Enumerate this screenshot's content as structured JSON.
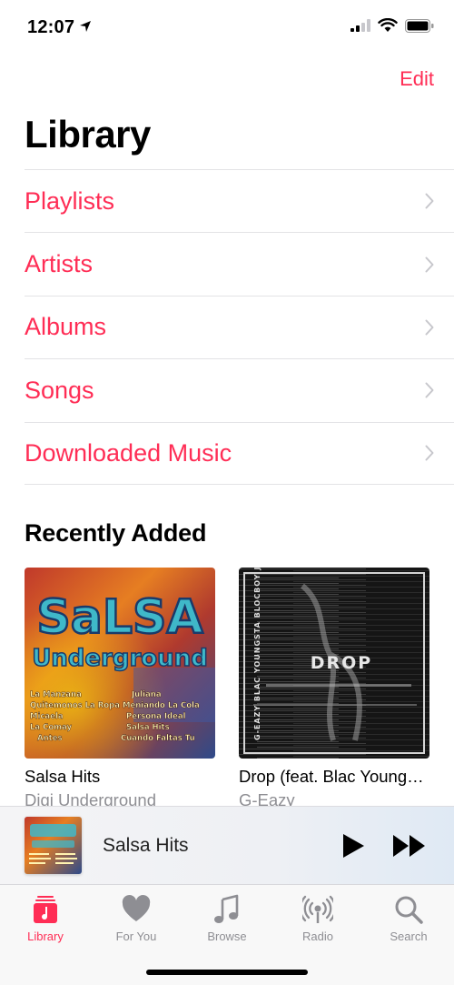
{
  "status_bar": {
    "time": "12:07"
  },
  "header": {
    "edit_label": "Edit",
    "title": "Library"
  },
  "menu": {
    "items": [
      {
        "label": "Playlists"
      },
      {
        "label": "Artists"
      },
      {
        "label": "Albums"
      },
      {
        "label": "Songs"
      },
      {
        "label": "Downloaded Music"
      }
    ]
  },
  "recently_added": {
    "title": "Recently Added",
    "albums": [
      {
        "title": "Salsa Hits",
        "artist": "Digi Underground",
        "art_title": "SaLSA",
        "art_subtitle": "Underground",
        "art_tracks_left": [
          "La Manzana",
          "Quitemonos La Ropa",
          "Micaela",
          "La Comay",
          "Antes"
        ],
        "art_tracks_right": [
          "Juliana",
          "Meniando La Cola",
          "Persona Ideal",
          "Salsa Hits",
          "Cuando Faltas Tu"
        ]
      },
      {
        "title": "Drop (feat. Blac Youngsta & BlocBoy JB)",
        "artist": "G-Eazy",
        "art_title": "DROP",
        "art_spine": "G-EAZY   BLAC YOUNGSTA   BLOCBOY JB"
      }
    ]
  },
  "now_playing": {
    "title": "Salsa Hits"
  },
  "tabs": [
    {
      "label": "Library",
      "icon": "library-icon",
      "active": true
    },
    {
      "label": "For You",
      "icon": "heart-icon",
      "active": false
    },
    {
      "label": "Browse",
      "icon": "music-note-icon",
      "active": false
    },
    {
      "label": "Radio",
      "icon": "radio-icon",
      "active": false
    },
    {
      "label": "Search",
      "icon": "search-icon",
      "active": false
    }
  ],
  "colors": {
    "accent": "#ff2d55",
    "secondary_text": "#8e8e93"
  }
}
